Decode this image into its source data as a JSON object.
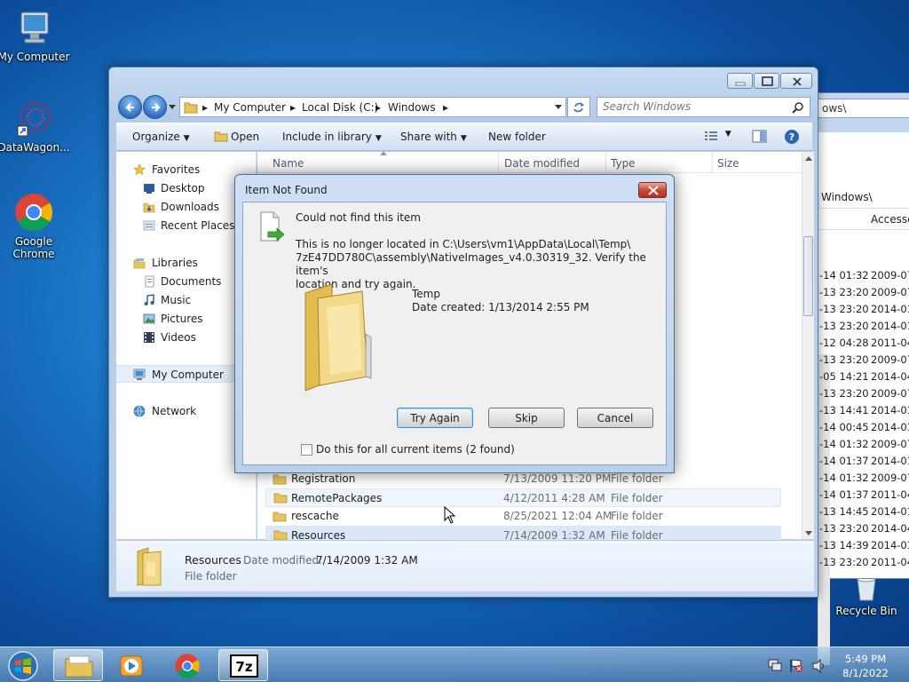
{
  "desktop": {
    "icons": [
      {
        "label": "My Computer"
      },
      {
        "label": "DataWagon..."
      },
      {
        "label": "Google Chrome"
      },
      {
        "label": "Recycle Bin"
      }
    ]
  },
  "bg_window": {
    "address": "ows\\",
    "address2": "Windows\\",
    "col": "Accesse",
    "rows": [
      [
        "-14 01:32",
        "2009-07-"
      ],
      [
        "-13 23:20",
        "2009-07-"
      ],
      [
        "-13 23:20",
        "2014-01-"
      ],
      [
        "-13 23:20",
        "2014-01-"
      ],
      [
        "-12 04:28",
        "2011-04-"
      ],
      [
        "-13 23:20",
        "2009-07-"
      ],
      [
        "-05 14:21",
        "2014-04-"
      ],
      [
        "-13 23:20",
        "2009-07-"
      ],
      [
        "-13 14:41",
        "2014-01-"
      ],
      [
        "-14 00:45",
        "2014-01-"
      ],
      [
        "-14 01:32",
        "2009-07-"
      ],
      [
        "-14 01:37",
        "2014-01-"
      ],
      [
        "-14 01:32",
        "2009-07-"
      ],
      [
        "-14 01:37",
        "2011-04-"
      ],
      [
        "-13 14:45",
        "2014-01-"
      ],
      [
        "-13 23:20",
        "2014-04-"
      ],
      [
        "-13 14:39",
        "2014-01-"
      ],
      [
        "-13 23:20",
        "2011-04-"
      ]
    ]
  },
  "explorer": {
    "breadcrumb": [
      "My Computer",
      "Local Disk (C:)",
      "Windows"
    ],
    "search_placeholder": "Search Windows",
    "toolbar": {
      "organize": "Organize",
      "open": "Open",
      "include": "Include in library",
      "share": "Share with",
      "new_folder": "New folder"
    },
    "nav": {
      "favorites": "Favorites",
      "desktop": "Desktop",
      "downloads": "Downloads",
      "recent": "Recent Places",
      "libraries": "Libraries",
      "documents": "Documents",
      "music": "Music",
      "pictures": "Pictures",
      "videos": "Videos",
      "computer": "My Computer",
      "network": "Network"
    },
    "columns": {
      "name": "Name",
      "date": "Date modified",
      "type": "Type",
      "size": "Size"
    },
    "files": [
      {
        "name": "Registration",
        "date": "7/13/2009 11:20 PM",
        "type": "File folder"
      },
      {
        "name": "RemotePackages",
        "date": "4/12/2011 4:28 AM",
        "type": "File folder"
      },
      {
        "name": "rescache",
        "date": "8/25/2021 12:04 AM",
        "type": "File folder"
      },
      {
        "name": "Resources",
        "date": "7/14/2009 1:32 AM",
        "type": "File folder"
      }
    ],
    "details": {
      "name": "Resources",
      "date_label": "Date modified:",
      "date_value": "7/14/2009 1:32 AM",
      "type": "File folder"
    }
  },
  "dialog": {
    "title": "Item Not Found",
    "heading": "Could not find this item",
    "message_line1": "This is no longer located in C:\\Users\\vm1\\AppData\\Local\\Temp\\",
    "message_line2": "7zE47DD780C\\assembly\\NativeImages_v4.0.30319_32. Verify the item's",
    "message_line3": "location and try again.",
    "item_name": "Temp",
    "item_date": "Date created: 1/13/2014 2:55 PM",
    "try_again": "Try Again",
    "skip": "Skip",
    "cancel": "Cancel",
    "checkbox_label": "Do this for all current items (2 found)"
  },
  "taskbar": {
    "time": "5:49 PM",
    "date": "8/1/2022",
    "apps": [
      "start-orb",
      "windows-explorer",
      "media-player",
      "chrome",
      "7zip"
    ]
  },
  "colors": {
    "dialog_close": "#c94a33",
    "selection": "#e5eef9",
    "desktop_blue": "#1b78c8"
  }
}
